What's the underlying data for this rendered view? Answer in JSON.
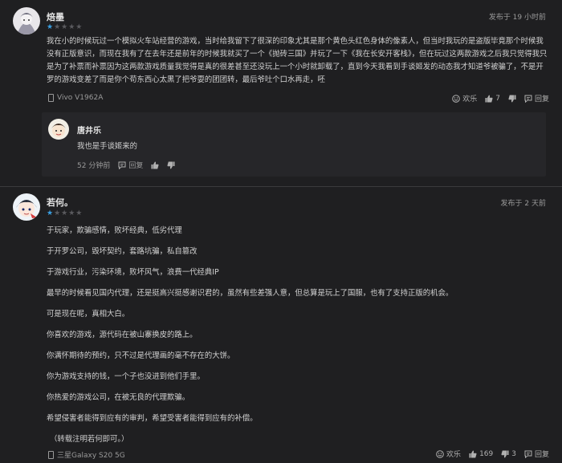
{
  "reviews": [
    {
      "username": "焙墨",
      "rating": 1,
      "posted": "发布于 19 小时前",
      "body": "我在小的时候玩过一个模拟火车站经营的游戏，当时给我留下了很深的印象尤其是那个黄色头红色身体的像素人，但当时我玩的是盗版毕竟那个时候我没有正版意识，而现在我有了在去年还是前年的时候我就买了一个《抛砖三国》并玩了一下《我在长安开客栈》，但在玩过这两款游戏之后我只觉得我只是为了补票而补票因为这两款游戏质量我觉得是真的很差甚至还没玩上一个小时就卸载了，直到今天我看到手谈姬发的动态我才知道爷被骗了，不是开罗的游戏变差了而是你个苟东西心太黑了把爷耍的团团转，最后爷吐个口水再走，呸",
      "device": "Vivo V1962A",
      "actions": {
        "fun": "欢乐",
        "likes": "7",
        "replies": "回复"
      },
      "reply": {
        "username": "唐井乐",
        "text": "我也是手谈姬来的",
        "time": "52 分钟前",
        "reply_label": "回复"
      }
    },
    {
      "username": "若何。",
      "rating": 1,
      "posted": "发布于 2 天前",
      "paragraphs": [
        "于玩家，欺骗感情，败坏经典，低劣代理",
        "于开罗公司，毁坏契约，套路坑骗，私自篡改",
        "于游戏行业，污染环境，败坏风气，浪费一代经典IP",
        "最早的时候看见国内代理，还是挺高兴挺感谢识君的，虽然有些差强人意，但总算是玩上了国服，也有了支持正版的机会。",
        "可是现在呢，真相大白。",
        "你喜欢的游戏，源代码在被山寨换皮的路上。",
        "你满怀期待的预约，只不过是代理画的毫不存在的大饼。",
        "你为游戏支持的钱，一个子也没进到他们手里。",
        "你热爱的游戏公司，在被无良的代理欺骗。",
        "希望侵害者能得到应有的审判，希望受害者能得到应有的补偿。",
        "（转载注明若何即可。）"
      ],
      "device": "三星Galaxy S20 5G",
      "actions": {
        "fun": "欢乐",
        "likes": "169",
        "dislikes": "3",
        "replies": "回复"
      }
    }
  ],
  "colors": {
    "background": "#1f1f21",
    "star_active": "#3aa0e3",
    "star_inactive": "#5a5a5e",
    "reply_bg": "#262629"
  }
}
